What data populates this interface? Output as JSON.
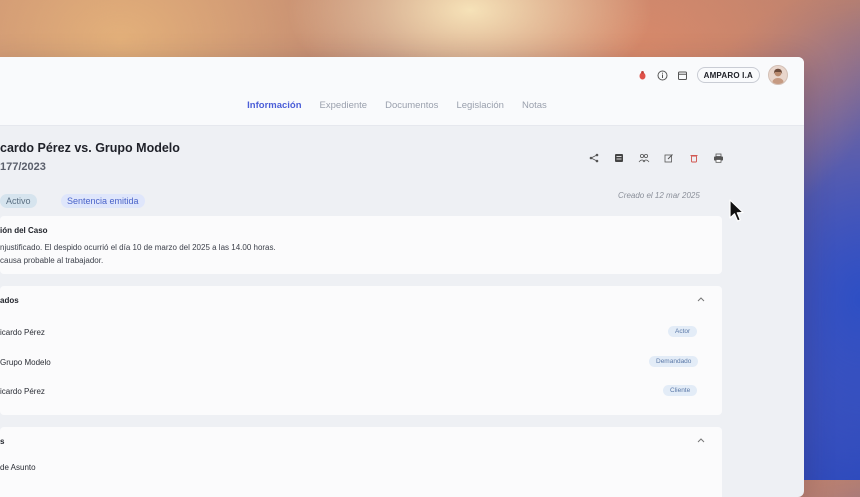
{
  "topbar": {
    "brand": "AMPARO I.A",
    "icons": [
      "bug-icon",
      "info-icon",
      "calendar-icon"
    ]
  },
  "tabs": [
    {
      "label": "Información",
      "active": true
    },
    {
      "label": "Expediente",
      "active": false
    },
    {
      "label": "Documentos",
      "active": false
    },
    {
      "label": "Legislación",
      "active": false
    },
    {
      "label": "Notas",
      "active": false
    }
  ],
  "case": {
    "title": "cardo Pérez vs. Grupo Modelo",
    "number": "177/2023",
    "status_badge": "Activo",
    "stage_badge": "Sentencia emitida",
    "created": "Creado el 12 mar 2025"
  },
  "actions": [
    "share-icon",
    "list-icon",
    "users-icon",
    "edit-icon",
    "delete-icon",
    "print-icon"
  ],
  "description": {
    "title": "ión del Caso",
    "line1": "njustificado. El despido ocurrió el día 10 de marzo del 2025 a las 14.00 horas.",
    "line2": "causa probable al trabajador."
  },
  "parties": {
    "title": "ados",
    "rows": [
      {
        "name": "icardo Pérez",
        "role": "Actor"
      },
      {
        "name": "Grupo Modelo",
        "role": "Demandado"
      },
      {
        "name": "icardo Pérez",
        "role": "Cliente"
      }
    ]
  },
  "details": {
    "title": "s",
    "first_row": "de Asunto"
  }
}
